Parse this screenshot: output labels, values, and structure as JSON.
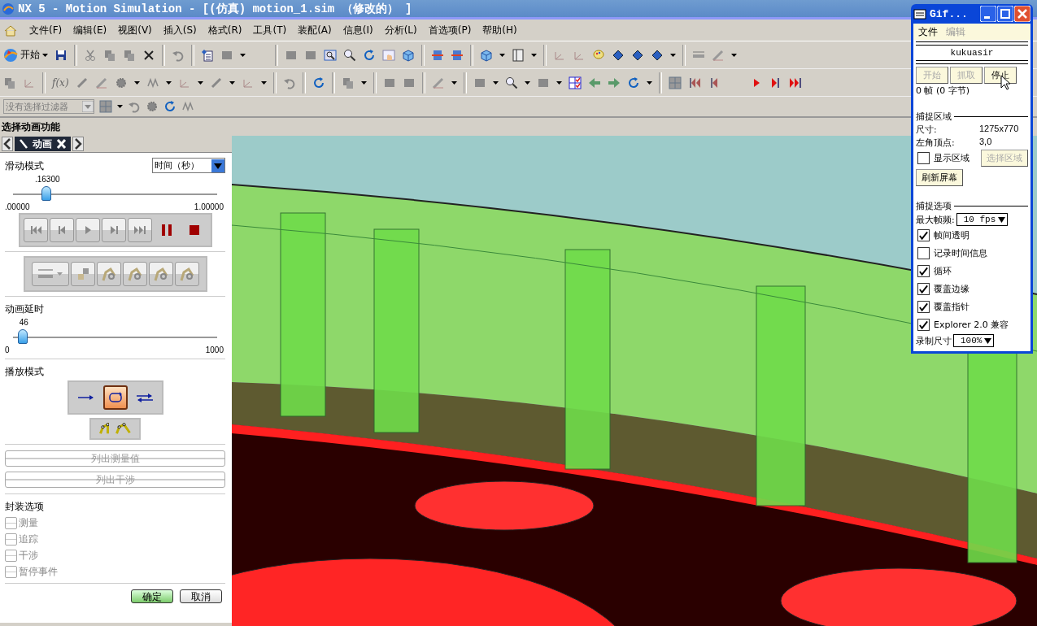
{
  "window": {
    "title": "NX 5 - Motion Simulation - [(仿真) motion_1.sim （修改的） ]"
  },
  "menu": [
    "文件(F)",
    "编辑(E)",
    "视图(V)",
    "插入(S)",
    "格式(R)",
    "工具(T)",
    "装配(A)",
    "信息(I)",
    "分析(L)",
    "首选项(P)",
    "帮助(H)"
  ],
  "toolbar": {
    "start_button": "开始",
    "function_button": "f(x)",
    "filter_dropdown": {
      "value": "没有选择过滤器",
      "disabled": true
    }
  },
  "cue_line": "选择动画功能",
  "panel": {
    "tab": {
      "label": "动画",
      "selected": true
    },
    "slide_mode": {
      "label": "滑动模式",
      "dropdown": "时间（秒）"
    },
    "time_slider": {
      "value": ".16300",
      "min": ".00000",
      "max": "1.00000",
      "level": 0.163
    },
    "delay": {
      "label": "动画延时",
      "value": "46",
      "min": "0",
      "max": "1000",
      "level": 0.046
    },
    "play_mode": {
      "label": "播放模式",
      "modes": [
        {
          "kind": "once",
          "selected": false
        },
        {
          "kind": "loop",
          "selected": true
        },
        {
          "kind": "reverse",
          "selected": false
        }
      ]
    },
    "list_buttons": [
      {
        "label": "列出测量值",
        "disabled": true
      },
      {
        "label": "列出干涉",
        "disabled": true
      }
    ],
    "package_options": {
      "label": "封装选项",
      "items": [
        {
          "label": "测量",
          "checked": false,
          "disabled": true
        },
        {
          "label": "追踪",
          "checked": false,
          "disabled": true
        },
        {
          "label": "干涉",
          "checked": false,
          "disabled": true
        },
        {
          "label": "暂停事件",
          "checked": false,
          "disabled": true
        }
      ]
    },
    "buttons": [
      {
        "label": "确定",
        "kind": "ok"
      },
      {
        "label": "取消",
        "kind": "cancel"
      }
    ]
  },
  "gif_window": {
    "title": "Gif...",
    "menu": [
      {
        "label": "文件",
        "disabled": false
      },
      {
        "label": "编辑",
        "disabled": true
      }
    ],
    "name": "kukuasir",
    "buttons": [
      {
        "label": "开始",
        "disabled": true
      },
      {
        "label": "抓取",
        "disabled": true
      },
      {
        "label": "停止",
        "disabled": false
      }
    ],
    "status": "0 帧 (0 字节)",
    "capture_area": {
      "title": "捕捉区域",
      "fields": [
        {
          "label": "尺寸:",
          "value": "1275x770"
        },
        {
          "label": "左角顶点:",
          "value": "3,0"
        }
      ],
      "show_area": {
        "label": "显示区域",
        "checked": false
      },
      "select_button": {
        "label": "选择区域",
        "disabled": true
      },
      "refresh_button": "刷新屏幕"
    },
    "capture_options": {
      "title": "捕捉选项",
      "max_fps": {
        "label": "最大帧频:",
        "value": "10 fps"
      },
      "checkboxes": [
        {
          "label": "帧间透明",
          "checked": true
        },
        {
          "label": "记录时间信息",
          "checked": false
        },
        {
          "label": "循环",
          "checked": true
        },
        {
          "label": "覆盖边缘",
          "checked": true
        },
        {
          "label": "覆盖指针",
          "checked": true
        },
        {
          "label": "Explorer 2.0 兼容",
          "checked": true
        }
      ],
      "record_size": {
        "label": "录制尺寸",
        "value": "100%"
      }
    }
  }
}
